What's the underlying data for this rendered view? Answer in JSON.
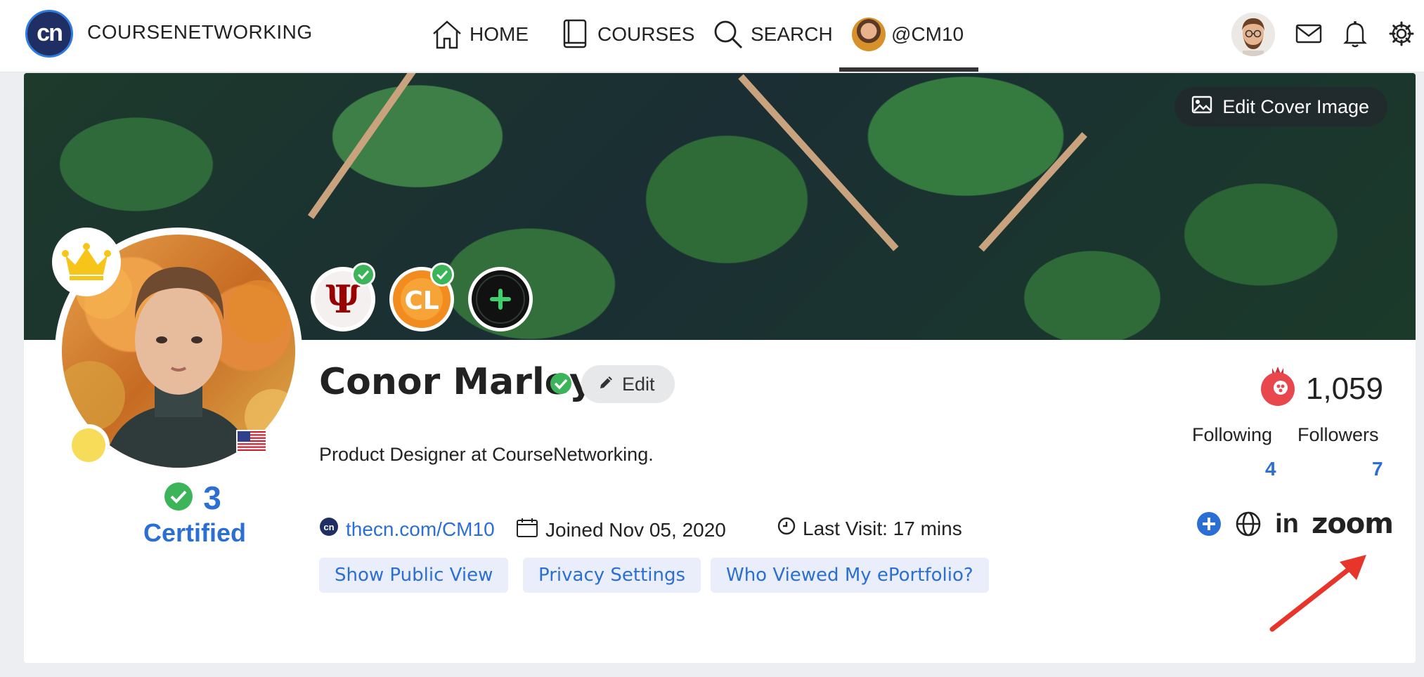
{
  "nav": {
    "brand": "COURSENETWORKING",
    "logo_text": "cn",
    "items": [
      {
        "label": "HOME"
      },
      {
        "label": "COURSES"
      },
      {
        "label": "SEARCH"
      },
      {
        "label": "@CM10"
      }
    ]
  },
  "cover": {
    "edit_label": "Edit Cover Image"
  },
  "badges": [
    {
      "name": "Indiana University",
      "text": "Ψ"
    },
    {
      "name": "CourseNetworking Learning",
      "text": "CL"
    }
  ],
  "profile": {
    "name": "Conor Marley",
    "edit_label": "Edit",
    "bio": "Product Designer at CourseNetworking.",
    "certified_count": "3",
    "certified_label": "Certified",
    "link_text": "thecn.com/CM10",
    "joined": "Joined Nov 05, 2020",
    "last_visit": "Last Visit: 17 mins",
    "score": "1,059",
    "following_label": "Following",
    "followers_label": "Followers",
    "following_count": "4",
    "followers_count": "7"
  },
  "actions": {
    "public_view": "Show Public View",
    "privacy": "Privacy Settings",
    "viewed": "Who Viewed My ePortfolio?"
  },
  "social": {
    "zoom_text": "zoom",
    "linkedin_text": "in"
  },
  "colors": {
    "accent_blue": "#2b6fd4",
    "check_green": "#3cb55a",
    "score_red": "#e8474e",
    "annotation_red": "#e8352b"
  }
}
